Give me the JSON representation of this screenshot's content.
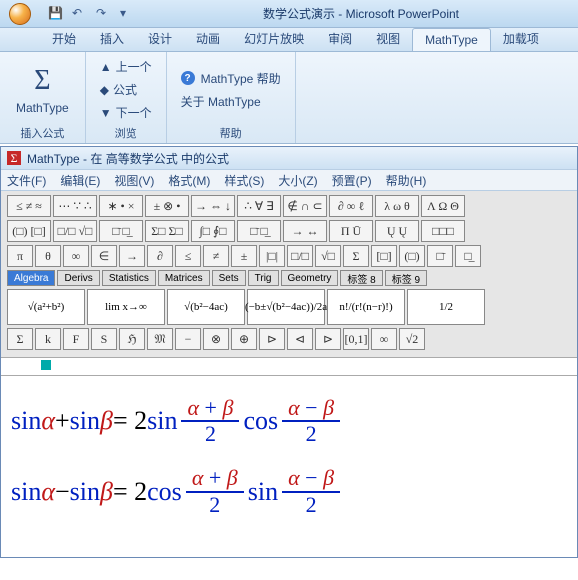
{
  "titlebar": {
    "title": "数学公式演示 - Microsoft PowerPoint"
  },
  "tabs": {
    "items": [
      {
        "label": "开始"
      },
      {
        "label": "插入"
      },
      {
        "label": "设计"
      },
      {
        "label": "动画"
      },
      {
        "label": "幻灯片放映"
      },
      {
        "label": "审阅"
      },
      {
        "label": "视图"
      },
      {
        "label": "MathType"
      },
      {
        "label": "加载项"
      }
    ],
    "active": 7
  },
  "ribbon": {
    "insert": {
      "label": "MathType",
      "group_label": "插入公式"
    },
    "browse": {
      "prev": "上一个",
      "formula": "公式",
      "next": "下一个",
      "group_label": "浏览"
    },
    "help": {
      "help": "MathType 帮助",
      "about": "关于 MathType",
      "group_label": "帮助"
    }
  },
  "mt": {
    "title": "MathType - 在 高等数学公式 中的公式",
    "menu": [
      "文件(F)",
      "编辑(E)",
      "视图(V)",
      "格式(M)",
      "样式(S)",
      "大小(Z)",
      "预置(P)",
      "帮助(H)"
    ],
    "row1": [
      "≤ ≠ ≈",
      "⋯ ∵ ∴",
      "∗ • ×",
      "± ⊗ •",
      "→ ⇔ ↓",
      "∴ ∀ ∃",
      "∉ ∩ ⊂",
      "∂ ∞ ℓ",
      "λ ω θ",
      "Λ Ω Θ"
    ],
    "row2": [
      "(□) [□]",
      "□/□ √□",
      "□̄ □̲",
      "Σ□ Σ□",
      "∫□ ∮□",
      "□̄ □̲",
      "→ ↔",
      "Π Ū",
      "Ų Ų",
      "□□□"
    ],
    "row3": [
      "π",
      "θ",
      "∞",
      "∈",
      "→",
      "∂",
      "≤",
      "≠",
      "±",
      "|□|",
      "□/□",
      "√□",
      "Σ",
      "[□]",
      "(□)",
      "□̄",
      "□̲"
    ],
    "tabrow": [
      "Algebra",
      "Derivs",
      "Statistics",
      "Matrices",
      "Sets",
      "Trig",
      "Geometry",
      "标签 8",
      "标签 9"
    ],
    "tplrow": [
      "√(a²+b²)",
      "lim x→∞",
      "√(b²−4ac)",
      "(−b±√(b²−4ac))/2a",
      "n!/(r!(n−r)!)",
      "1/2"
    ],
    "row5": [
      "Σ",
      "k",
      "F",
      "S",
      "ℌ",
      "𝔐",
      "−",
      "⊗",
      "⊕",
      "⊳",
      "⊲",
      "⊳",
      "[0,1]",
      "∞",
      "√2"
    ]
  },
  "equations": {
    "e1": {
      "l1": "sin",
      "a": "α",
      "plus": " + ",
      "l2": "sin",
      "b": "β",
      "eq": " = 2",
      "f1": "sin",
      "num1a": "α",
      "num1p": " + ",
      "num1b": "β",
      "den1": "2",
      "f2": "cos",
      "num2a": "α",
      "num2m": " − ",
      "num2b": "β",
      "den2": "2"
    },
    "e2": {
      "l1": "sin",
      "a": "α",
      "minus": " − ",
      "l2": "sin",
      "b": "β",
      "eq": " = 2",
      "f1": "cos",
      "num1a": "α",
      "num1p": " + ",
      "num1b": "β",
      "den1": "2",
      "f2": "sin",
      "num2a": "α",
      "num2m": " − ",
      "num2b": "β",
      "den2": "2"
    }
  }
}
